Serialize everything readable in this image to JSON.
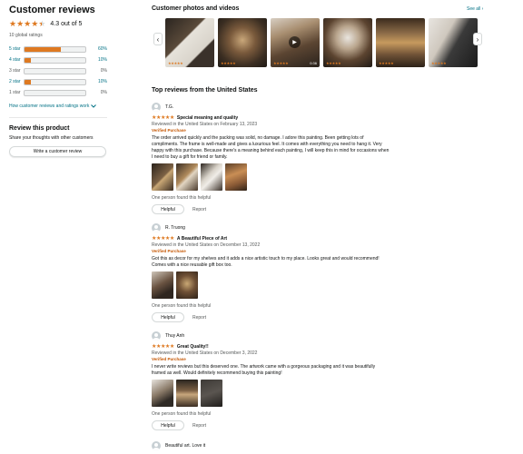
{
  "summary": {
    "title": "Customer reviews",
    "rating_text": "4.3 out of 5",
    "rating_value": 4.3,
    "global_ratings": "10 global ratings",
    "histogram": [
      {
        "label": "5 star",
        "pct": "60%",
        "value": 0.6
      },
      {
        "label": "4 star",
        "pct": "10%",
        "value": 0.1
      },
      {
        "label": "3 star",
        "pct": "0%",
        "value": 0.0
      },
      {
        "label": "2 star",
        "pct": "10%",
        "value": 0.1
      },
      {
        "label": "1 star",
        "pct": "0%",
        "value": 0.0
      }
    ],
    "how_link": "How customer reviews and ratings work",
    "review_product_title": "Review this product",
    "share_text": "Share your thoughts with other customers",
    "write_button": "Write a customer review"
  },
  "photos": {
    "title": "Customer photos and videos",
    "see_all": "See all ›",
    "video_duration": "0:36"
  },
  "top_reviews_title": "Top reviews from the United States",
  "reviews": [
    {
      "user": "T.G.",
      "title": "Special meaning and quality",
      "date": "Reviewed in the United States on February 13, 2023",
      "verified": "Verified Purchase",
      "body": "The order arrived quickly and the packing was solid, no damage. I adore this painting. Been getting lots of compliments. The frame is well-made and gives a luxurious feel. It comes with everything you need to hang it. Very happy with this purchase. Because there's a meaning behind each painting, I will keep this in mind for occasions when I need to buy a gift for friend or family.",
      "helpful_text": "One person found this helpful",
      "helpful_button": "Helpful",
      "report": "Report"
    },
    {
      "user": "R. Truong",
      "title": "A Beautiful Piece of Art",
      "date": "Reviewed in the United States on December 13, 2022",
      "verified": "Verified Purchase",
      "body": "Got this as decor for my shelves and it adds a nice artistic touch to my place. Looks great and would recommend! Comes with a nice reusable gift box too.",
      "helpful_text": "One person found this helpful",
      "helpful_button": "Helpful",
      "report": "Report"
    },
    {
      "user": "Thuy Anh",
      "title": "Great Quality!!",
      "date": "Reviewed in the United States on December 3, 2022",
      "verified": "Verified Purchase",
      "body": "I never write reviews but this deserved one. The artwork came with a gorgeous packaging and it was beautifully framed as well. Would definitely recommend buying this painting!",
      "helpful_text": "One person found this helpful",
      "helpful_button": "Helpful",
      "report": "Report"
    },
    {
      "user": "Beautiful art. Love it"
    }
  ],
  "colors": {
    "star": "#de7921",
    "link": "#007185",
    "verified": "#c45500"
  }
}
